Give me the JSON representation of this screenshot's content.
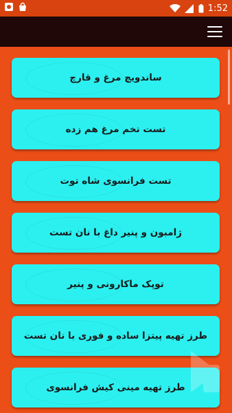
{
  "status_bar": {
    "time": "1:52",
    "icons": [
      "notification-icon",
      "shopping-bag-icon",
      "wifi-icon",
      "signal-icon",
      "battery-icon"
    ]
  },
  "toolbar": {
    "menu_icon": "hamburger-menu-icon"
  },
  "items": [
    {
      "label": "ساندویچ مرغ و قارچ"
    },
    {
      "label": "تست تخم مرغ هم زده"
    },
    {
      "label": "تست فرانسوی شاه توت"
    },
    {
      "label": "ژامبون و پنیر داغ با نان تست"
    },
    {
      "label": "توپک ماکارونی و پنیر"
    },
    {
      "label": "طرز تهیه پیتزا ساده و فوری با نان تست"
    },
    {
      "label": "طرز تهیه مینی کیش فرانسوی"
    }
  ],
  "colors": {
    "background": "#ec4e18",
    "status_bar": "#d8430f",
    "toolbar": "#200808",
    "card": "#2cf0f0"
  }
}
